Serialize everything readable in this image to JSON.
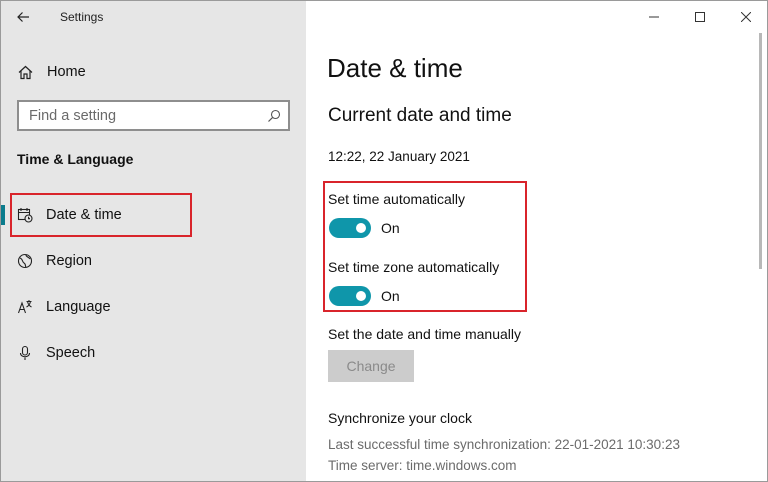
{
  "titlebar": {
    "title": "Settings"
  },
  "nav": {
    "home_label": "Home",
    "search_placeholder": "Find a setting",
    "section_title": "Time & Language",
    "items": [
      {
        "label": "Date & time",
        "icon": "calendar-clock-icon",
        "active": true
      },
      {
        "label": "Region",
        "icon": "globe-icon"
      },
      {
        "label": "Language",
        "icon": "language-icon"
      },
      {
        "label": "Speech",
        "icon": "microphone-icon"
      }
    ]
  },
  "main": {
    "title": "Date & time",
    "subtitle": "Current date and time",
    "current_datetime": "12:22, 22 January 2021",
    "set_time_auto": {
      "label": "Set time automatically",
      "state": "On"
    },
    "set_timezone_auto": {
      "label": "Set time zone automatically",
      "state": "On"
    },
    "manual": {
      "label": "Set the date and time manually",
      "button": "Change"
    },
    "sync": {
      "title": "Synchronize your clock",
      "last": "Last successful time synchronization: 22-01-2021 10:30:23",
      "server": "Time server: time.windows.com"
    }
  },
  "colors": {
    "accent": "#0f96aa",
    "highlight": "#d9242b",
    "nav_bg": "#e6e6e6"
  }
}
